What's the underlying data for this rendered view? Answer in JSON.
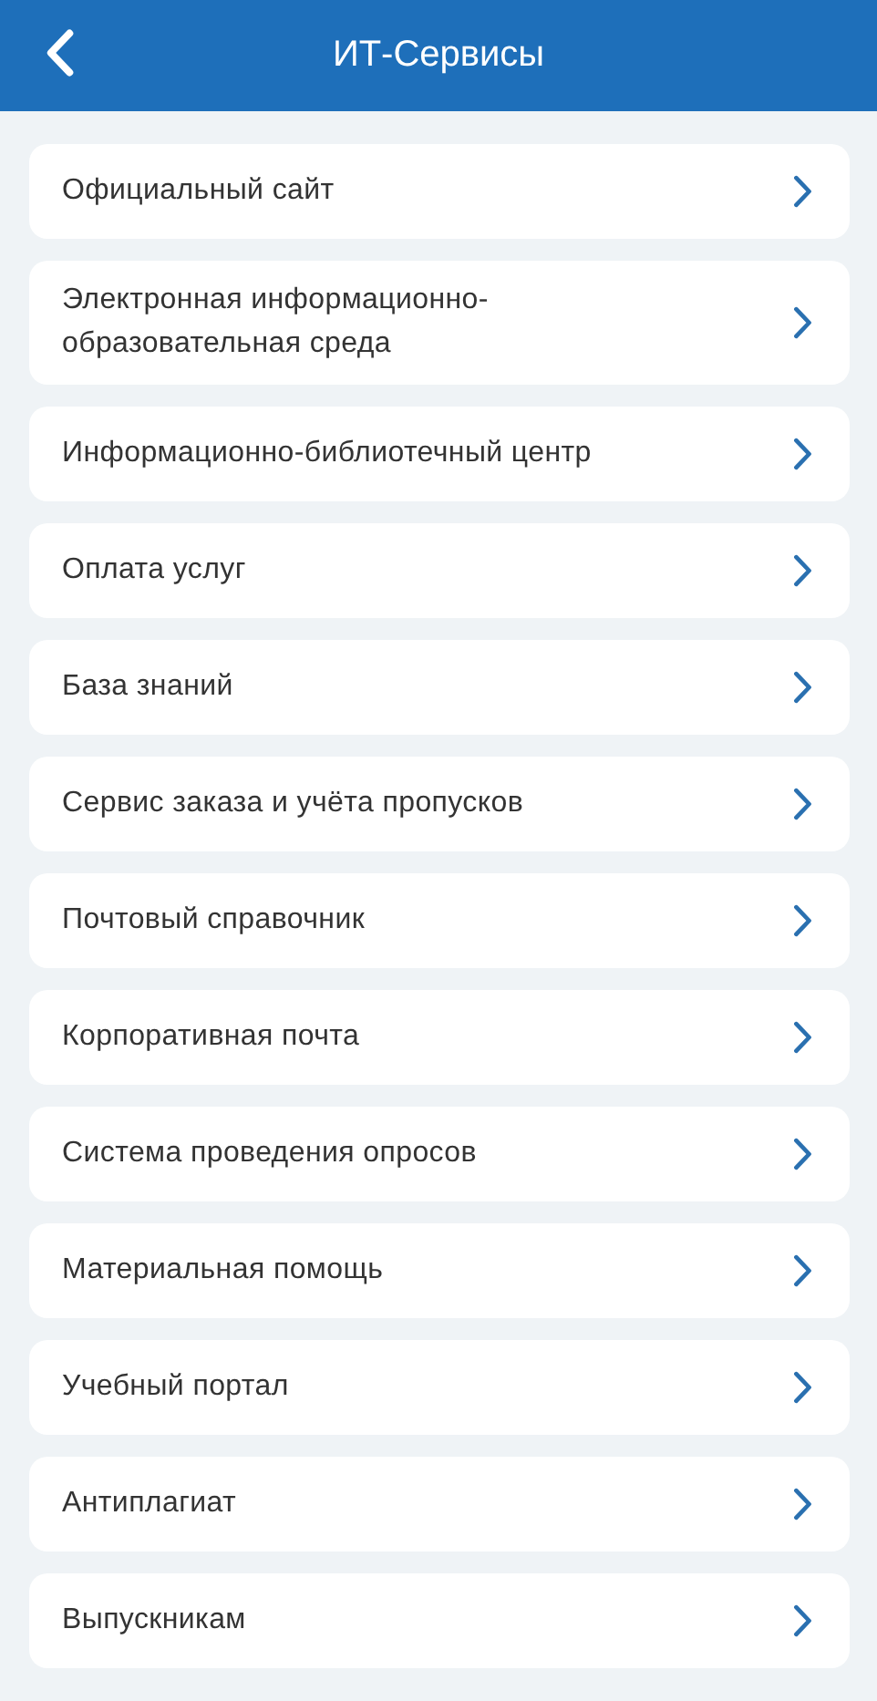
{
  "header": {
    "title": "ИТ-Сервисы"
  },
  "items": [
    {
      "label": "Официальный сайт"
    },
    {
      "label": "Электронная информационно-образовательная среда"
    },
    {
      "label": "Информационно-библиотечный центр"
    },
    {
      "label": "Оплата услуг"
    },
    {
      "label": "База знаний"
    },
    {
      "label": "Сервис заказа и учёта пропусков"
    },
    {
      "label": "Почтовый справочник"
    },
    {
      "label": "Корпоративная почта"
    },
    {
      "label": "Система проведения опросов"
    },
    {
      "label": "Материальная помощь"
    },
    {
      "label": "Учебный портал"
    },
    {
      "label": "Антиплагиат"
    },
    {
      "label": "Выпускникам"
    }
  ]
}
